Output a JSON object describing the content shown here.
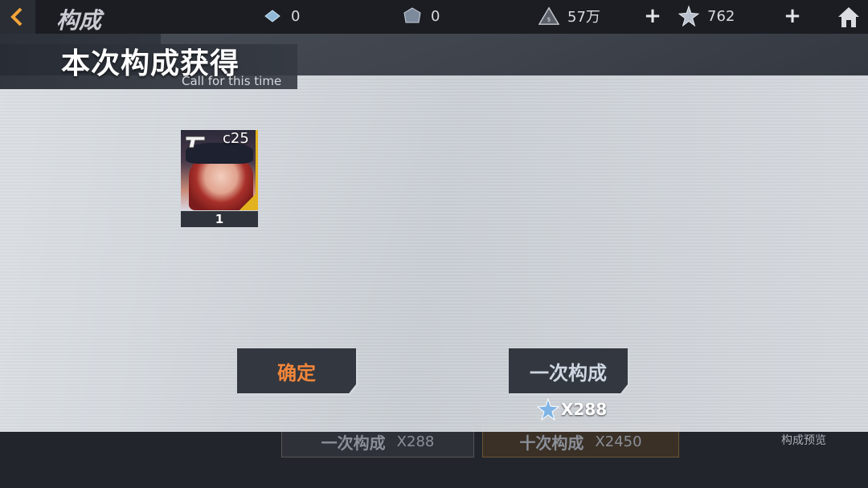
{
  "topbar": {
    "title": "构成",
    "resources": [
      {
        "icon": "crystal-icon",
        "value": "0"
      },
      {
        "icon": "mech-gem-icon",
        "value": "0"
      },
      {
        "icon": "coin-pile-icon",
        "value": "57万"
      },
      {
        "icon": "star-crystal-icon",
        "value": "762"
      }
    ],
    "plus": "+"
  },
  "background": {
    "bottom_once_label": "一次构成",
    "bottom_once_cost": "X288",
    "bottom_ten_label": "十次构成",
    "bottom_ten_cost": "X2450",
    "preview_label": "构成预览"
  },
  "modal": {
    "title": "本次构成获得",
    "subtitle": "Call for this time",
    "reward": {
      "label": "c25",
      "count": "1",
      "icon": "pistol-icon"
    },
    "confirm_label": "确定",
    "once_label": "一次构成",
    "once_cost": "X288"
  },
  "colors": {
    "confirm_text": "#f2863a",
    "rarity_gold": "#e3b21f",
    "button_bg": "#33373f"
  }
}
